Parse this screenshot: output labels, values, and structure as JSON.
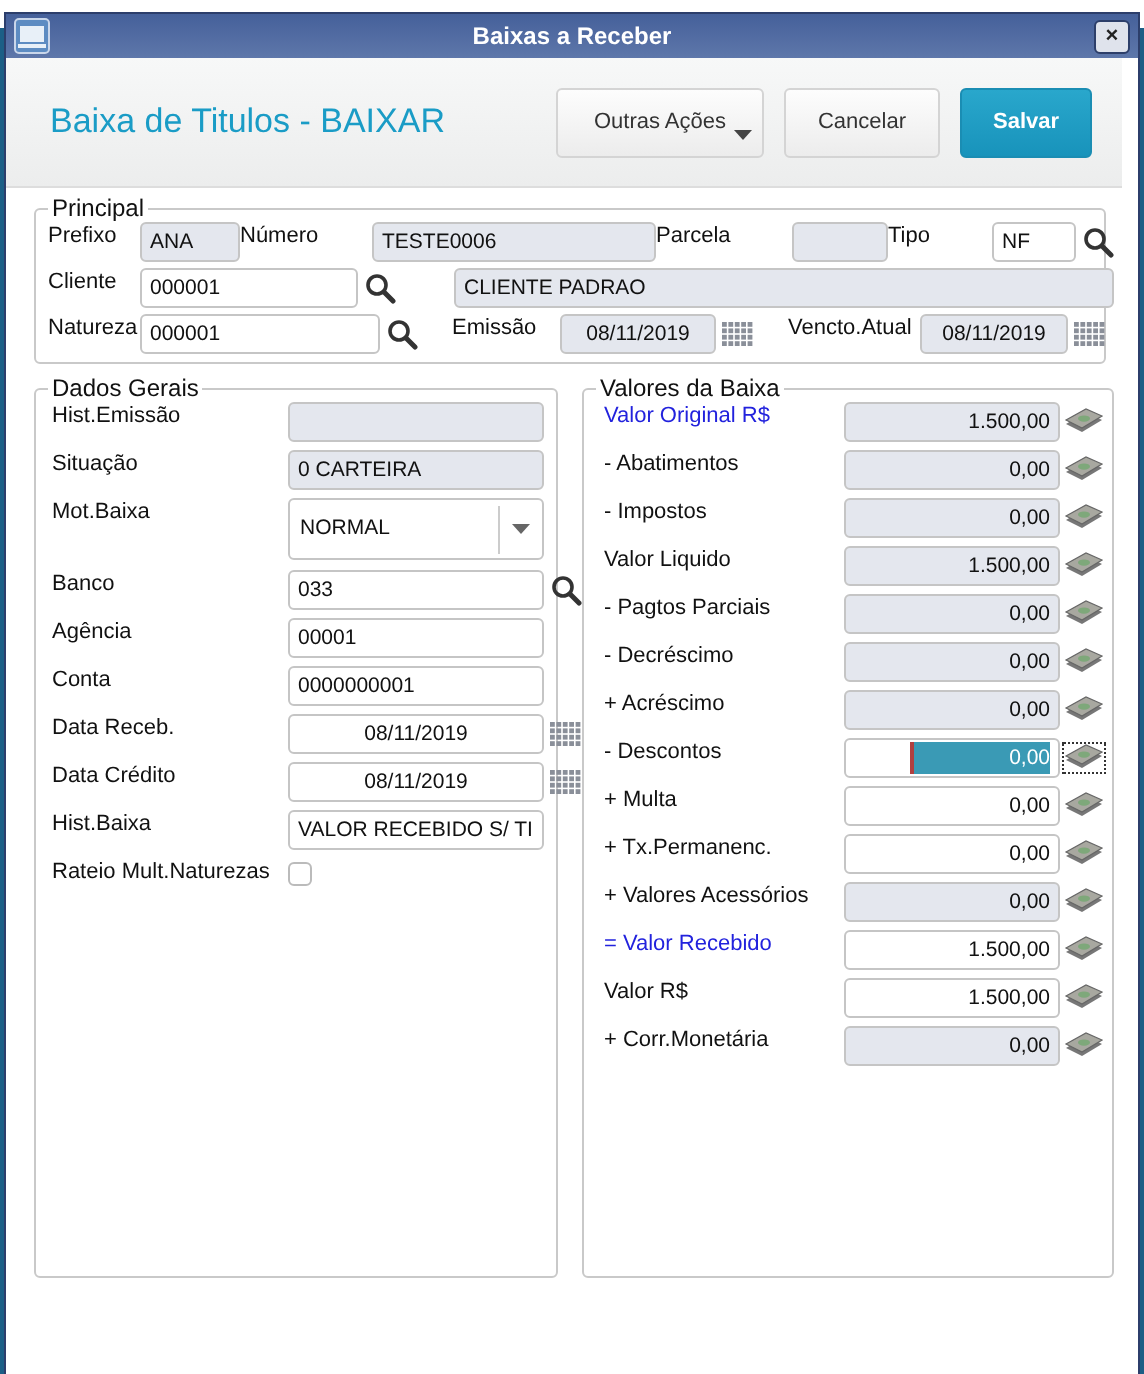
{
  "window": {
    "title": "Baixas a Receber",
    "close_label": "×"
  },
  "header": {
    "title": "Baixa de Titulos - BAIXAR",
    "buttons": [
      {
        "label": "Outras Ações",
        "kind": "menu"
      },
      {
        "label": "Cancelar",
        "kind": "plain"
      },
      {
        "label": "Salvar",
        "kind": "primary"
      }
    ]
  },
  "principal": {
    "legend": "Principal",
    "fields": [
      {
        "label": "Prefixo",
        "value": "ANA",
        "editable": false,
        "kind": "text"
      },
      {
        "label": "Número",
        "value": "TESTE0006",
        "editable": false,
        "kind": "text"
      },
      {
        "label": "Parcela",
        "editable": false,
        "kind": "text"
      },
      {
        "label": "Tipo",
        "value": "NF",
        "editable": true,
        "kind": "lookup"
      },
      {
        "label": "Cliente",
        "value": "000001",
        "editable": true,
        "kind": "lookup"
      },
      {
        "value": "CLIENTE PADRAO",
        "editable": false,
        "kind": "text"
      },
      {
        "label": "Natureza",
        "value": "000001",
        "editable": true,
        "kind": "lookup"
      },
      {
        "label": "Emissão",
        "value": "08/11/2019",
        "editable": false,
        "kind": "date"
      },
      {
        "label": "Vencto.Atual",
        "value": "08/11/2019",
        "editable": false,
        "kind": "date"
      }
    ]
  },
  "dados_gerais": {
    "legend": "Dados Gerais",
    "fields": [
      {
        "label": "Hist.Emissão",
        "kind": "text",
        "editable": false
      },
      {
        "label": "Situação",
        "kind": "text",
        "value": "0 CARTEIRA",
        "editable": false
      },
      {
        "label": "Mot.Baixa",
        "kind": "select",
        "value": "NORMAL"
      },
      {
        "label": "Banco",
        "kind": "lookup",
        "value": "033",
        "editable": true
      },
      {
        "label": "Agência",
        "kind": "text",
        "value": "00001",
        "editable": true
      },
      {
        "label": "Conta",
        "kind": "text",
        "value": "0000000001",
        "editable": true
      },
      {
        "label": "Data Receb.",
        "kind": "date",
        "value": "08/11/2019",
        "editable": true
      },
      {
        "label": "Data Crédito",
        "kind": "date",
        "value": "08/11/2019",
        "editable": true
      },
      {
        "label": "Hist.Baixa",
        "kind": "text",
        "value": "VALOR RECEBIDO S/ TI",
        "editable": true
      },
      {
        "label": "Rateio Mult.Naturezas",
        "kind": "checkbox",
        "checked": false
      }
    ]
  },
  "valores_da_baixa": {
    "legend": "Valores da Baixa",
    "fields": [
      {
        "label": "Valor Original R$",
        "value": "1.500,00",
        "editable": false,
        "selected": false,
        "color": "#2222dd"
      },
      {
        "label": "- Abatimentos",
        "value": "0,00",
        "editable": false,
        "selected": false,
        "color": "#111111"
      },
      {
        "label": "- Impostos",
        "value": "0,00",
        "editable": false,
        "selected": false,
        "color": "#111111"
      },
      {
        "label": "Valor Liquido",
        "value": "1.500,00",
        "editable": false,
        "selected": false,
        "color": "#111111"
      },
      {
        "label": "- Pagtos Parciais",
        "value": "0,00",
        "editable": false,
        "selected": false,
        "color": "#111111"
      },
      {
        "label": "- Decréscimo",
        "value": "0,00",
        "editable": false,
        "selected": false,
        "color": "#111111"
      },
      {
        "label": "+ Acréscimo",
        "value": "0,00",
        "editable": false,
        "selected": false,
        "color": "#111111"
      },
      {
        "label": "- Descontos",
        "value": "0,00",
        "editable": true,
        "selected": true,
        "color": "#111111"
      },
      {
        "label": "+ Multa",
        "value": "0,00",
        "editable": true,
        "selected": false,
        "color": "#111111"
      },
      {
        "label": "+ Tx.Permanenc.",
        "value": "0,00",
        "editable": true,
        "selected": false,
        "color": "#111111"
      },
      {
        "label": "+ Valores Acessórios",
        "value": "0,00",
        "editable": false,
        "selected": false,
        "color": "#111111"
      },
      {
        "label": "= Valor Recebido",
        "value": "1.500,00",
        "editable": true,
        "selected": false,
        "color": "#2222dd"
      },
      {
        "label": "Valor R$",
        "value": "1.500,00",
        "editable": true,
        "selected": false,
        "color": "#111111"
      },
      {
        "label": "+ Corr.Monetária",
        "value": "0,00",
        "editable": false,
        "selected": false,
        "color": "#111111"
      }
    ]
  }
}
